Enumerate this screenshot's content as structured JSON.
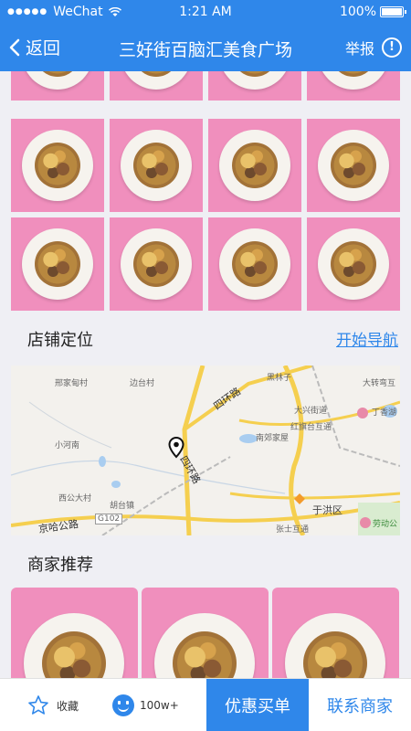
{
  "status_bar": {
    "carrier": "WeChat",
    "time": "1:21 AM",
    "battery": "100%"
  },
  "nav": {
    "back_label": "返回",
    "title": "三好街百脑汇美食广场",
    "report_label": "举报"
  },
  "shop_location": {
    "title": "店铺定位",
    "navigate_label": "开始导航"
  },
  "map": {
    "labels": {
      "xingjia": "邢家甸村",
      "biantai": "边台村",
      "heilin": "黑林子",
      "dazhuan": "大转弯互",
      "sihuan_top": "四环路",
      "daxing": "大兴街道",
      "dingxiang": "丁香湖",
      "xiaohenan": "小河南",
      "nanjia": "南郊家屋",
      "hongqitai": "红旗台互通",
      "sihuan_mid": "四环路",
      "xigong": "西公大村",
      "hutai": "胡台镇",
      "jingha": "京哈公路",
      "g102": "G102",
      "yuhong": "于洪区",
      "zhangshi": "张士互通",
      "laodong": "劳动公"
    }
  },
  "recommend": {
    "title": "商家推荐"
  },
  "bottom_bar": {
    "favorite_label": "收藏",
    "like_count": "100w+",
    "buy_label": "优惠买单",
    "contact_label": "联系商家"
  },
  "colors": {
    "primary": "#2f87ea",
    "photo_background": "#f08fbd",
    "page_background": "#efeff4"
  }
}
